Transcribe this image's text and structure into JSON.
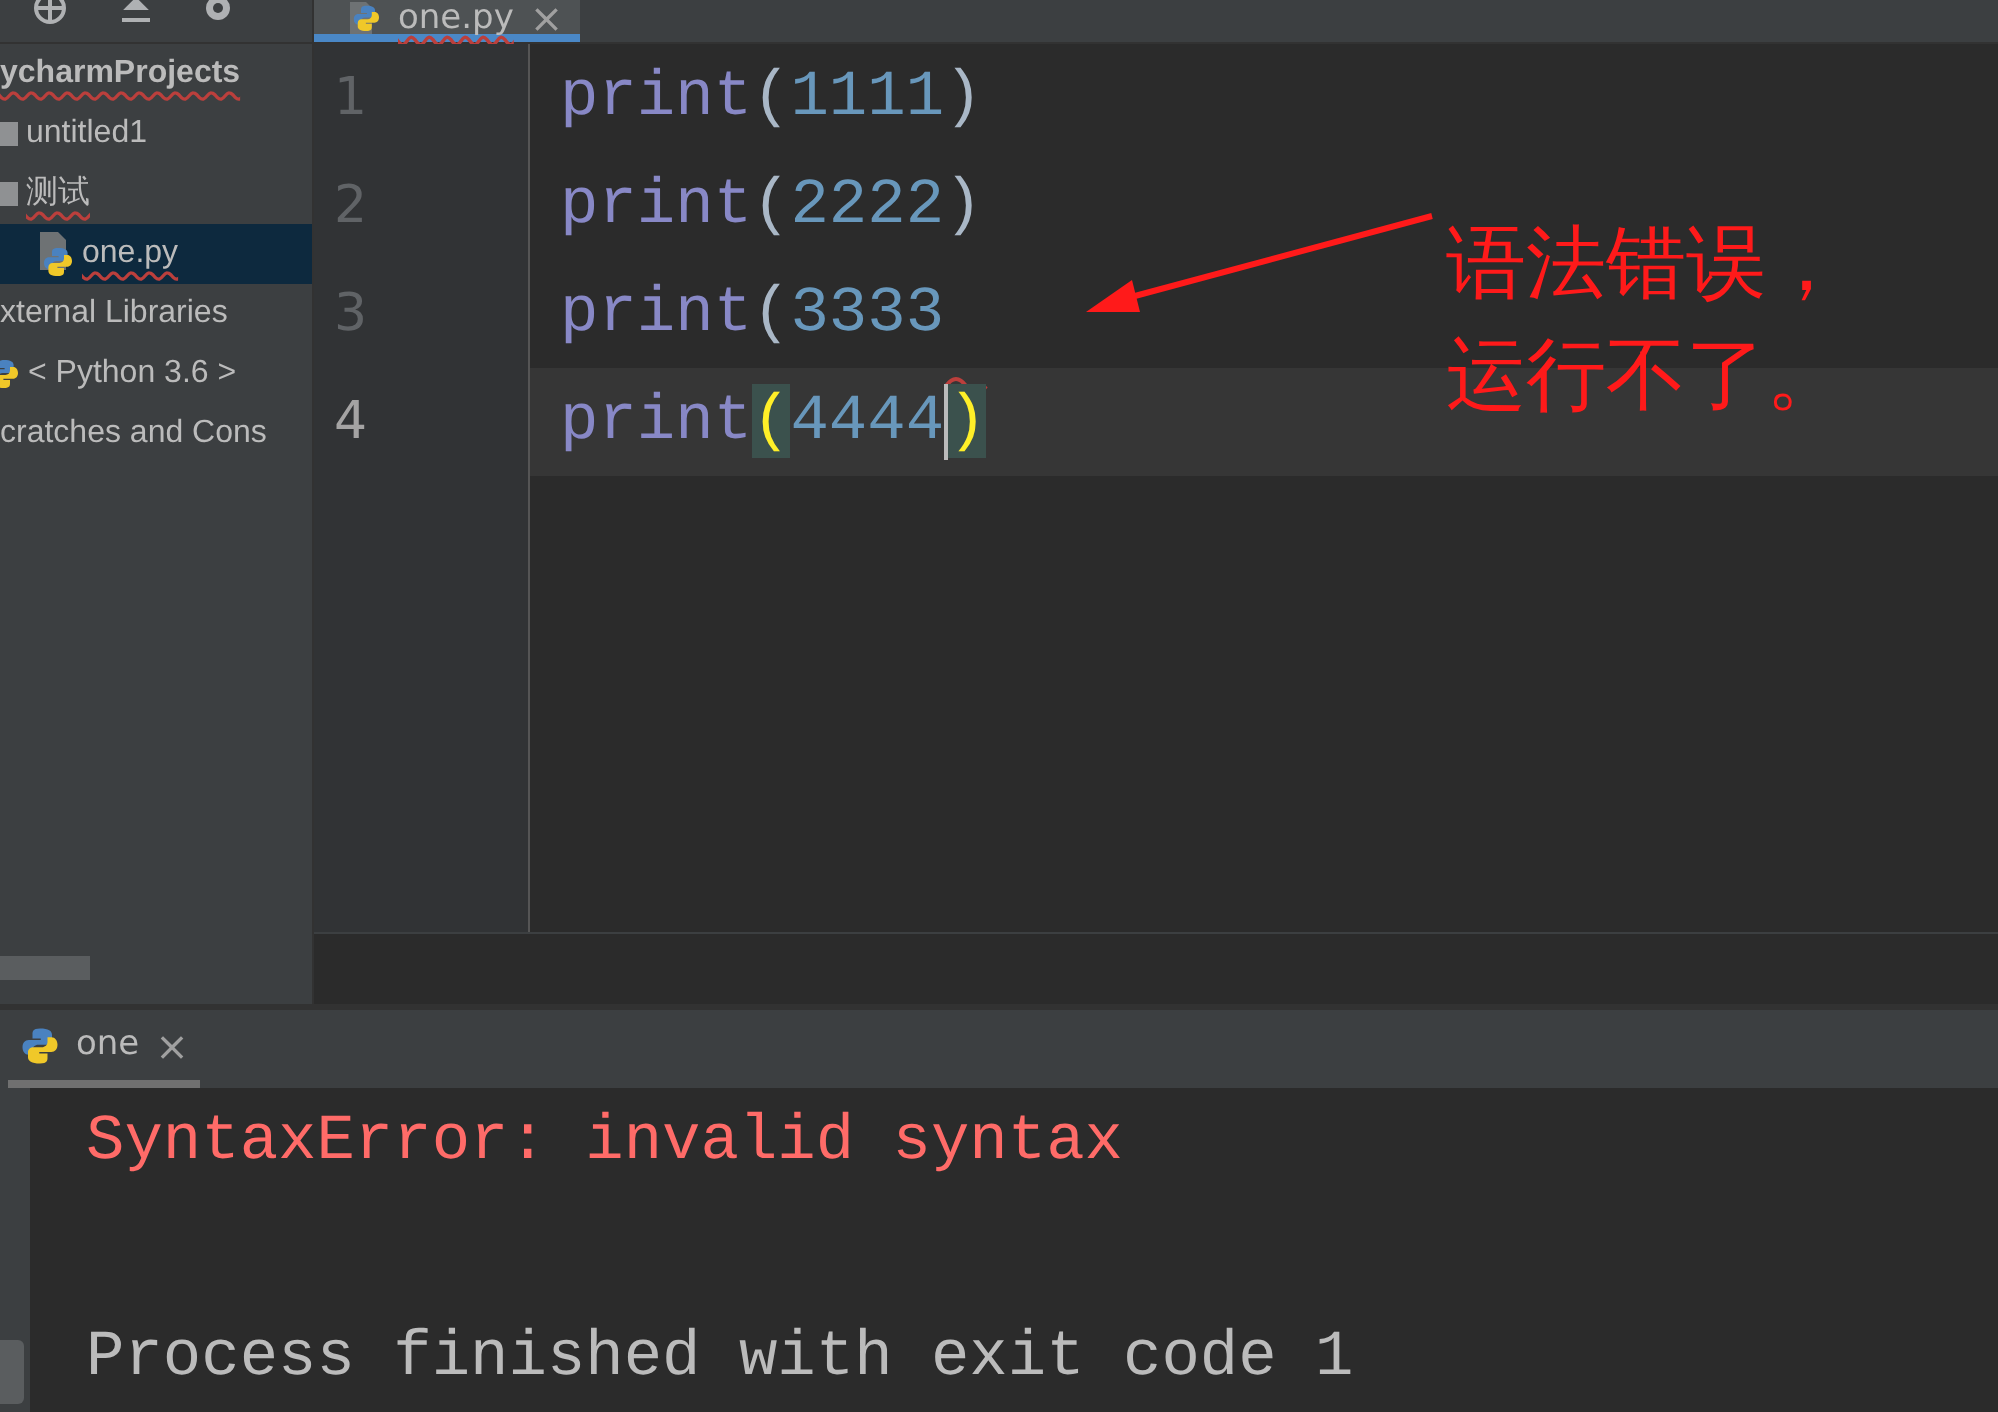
{
  "project_tree": [
    {
      "label": "ycharmProjects",
      "kind": "root",
      "selected": false,
      "has_error": true,
      "children": [
        {
          "label": "untitled1",
          "kind": "folder",
          "selected": false,
          "has_error": false
        },
        {
          "label": "测试",
          "kind": "folder",
          "selected": false,
          "has_error": true,
          "children": [
            {
              "label": "one.py",
              "kind": "pyfile",
              "selected": true,
              "has_error": true
            }
          ]
        }
      ]
    },
    {
      "label": "xternal Libraries",
      "kind": "library",
      "selected": false,
      "has_error": false,
      "children": [
        {
          "label": "< Python 3.6 >",
          "kind": "python",
          "selected": false,
          "has_error": false
        }
      ]
    },
    {
      "label": "cratches and Cons",
      "kind": "scratch",
      "selected": false,
      "has_error": false
    }
  ],
  "editor_tabs": [
    {
      "label": "one.py",
      "selected": true,
      "has_error": true,
      "close": "×"
    }
  ],
  "code_lines": [
    {
      "number": "1",
      "current": false,
      "error_after": false,
      "tokens": [
        {
          "kind": "builtin",
          "text": "print"
        },
        {
          "kind": "paren",
          "text": "("
        },
        {
          "kind": "number",
          "text": "1111"
        },
        {
          "kind": "paren",
          "text": ")"
        }
      ]
    },
    {
      "number": "2",
      "current": false,
      "error_after": false,
      "tokens": [
        {
          "kind": "builtin",
          "text": "print"
        },
        {
          "kind": "paren",
          "text": "("
        },
        {
          "kind": "number",
          "text": "2222"
        },
        {
          "kind": "paren",
          "text": ")"
        }
      ]
    },
    {
      "number": "3",
      "current": false,
      "error_after": true,
      "tokens": [
        {
          "kind": "builtin",
          "text": "print"
        },
        {
          "kind": "paren",
          "text": "("
        },
        {
          "kind": "number",
          "text": "3333"
        }
      ]
    },
    {
      "number": "4",
      "current": true,
      "error_after": false,
      "tokens": [
        {
          "kind": "builtin",
          "text": "print"
        },
        {
          "kind": "match",
          "text": "("
        },
        {
          "kind": "number",
          "text": "4444"
        },
        {
          "kind": "caret"
        },
        {
          "kind": "match",
          "text": ")"
        }
      ]
    }
  ],
  "annotation": {
    "lines": [
      "语法错误，",
      "运行不了。"
    ]
  },
  "run_tabs": [
    {
      "label": "one",
      "selected": true,
      "close": "×"
    }
  ],
  "console_lines": [
    {
      "kind": "error",
      "text": "SyntaxError: invalid syntax"
    },
    {
      "kind": "blank"
    },
    {
      "kind": "normal",
      "text": "Process finished with exit code 1"
    }
  ]
}
